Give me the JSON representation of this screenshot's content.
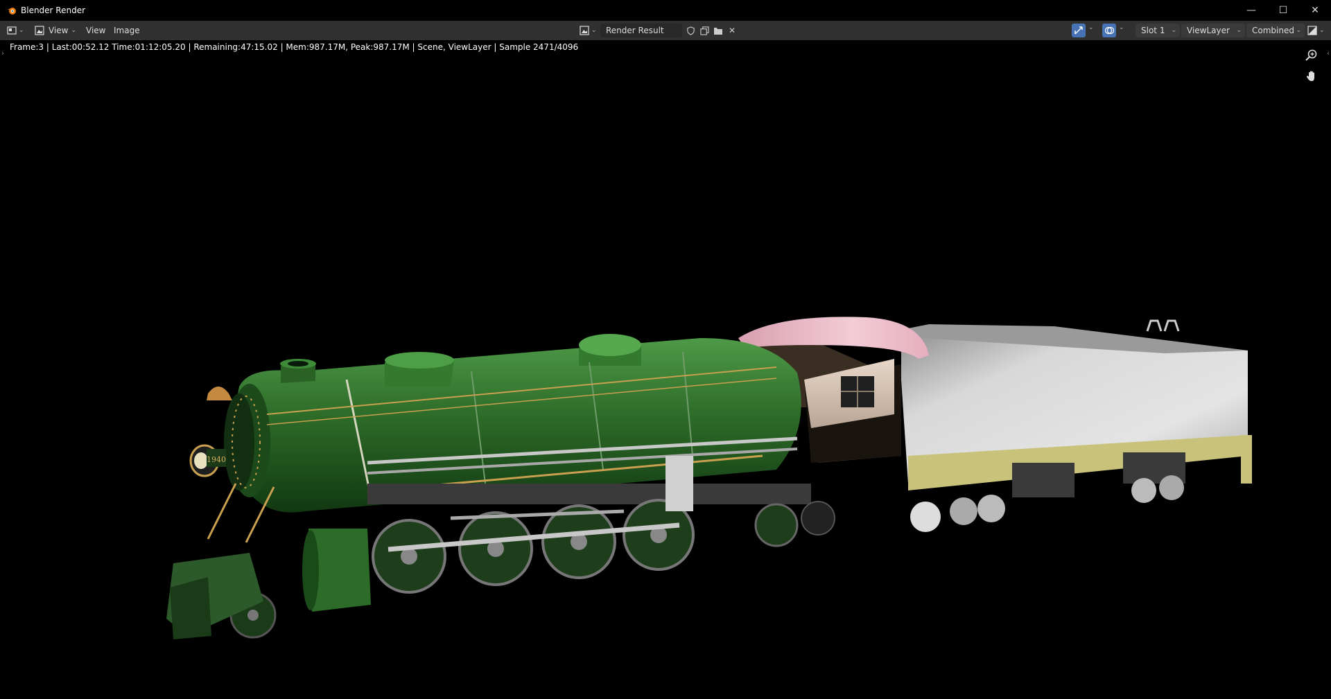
{
  "window": {
    "title": "Blender Render"
  },
  "window_controls": {
    "minimize": "—",
    "maximize": "☐",
    "close": "✕"
  },
  "header": {
    "menu_view_dropdown": "View",
    "menu_view": "View",
    "menu_image": "Image",
    "image_name": "Render Result",
    "slot": "Slot 1",
    "view_layer": "ViewLayer",
    "pass": "Combined"
  },
  "status_text": "Frame:3 | Last:00:52.12 Time:01:12:05.20 | Remaining:47:15.02 | Mem:987.17M, Peak:987.17M | Scene, ViewLayer | Sample 2471/4096",
  "render": {
    "number_plate": "1940"
  },
  "colors": {
    "header_bg": "#303030",
    "accent": "#4772b3",
    "engine_green": "#2f6b2a",
    "cab_pink": "#e8b4c0",
    "tender_silver": "#bdbdbd"
  },
  "icons": [
    "blender-logo-icon",
    "editor-type-icon",
    "image-icon",
    "shield-icon",
    "duplicate-icon",
    "folder-icon",
    "close-icon",
    "gizmo-icon",
    "overlay-icon",
    "display-channels-icon",
    "zoom-icon",
    "pan-hand-icon"
  ]
}
